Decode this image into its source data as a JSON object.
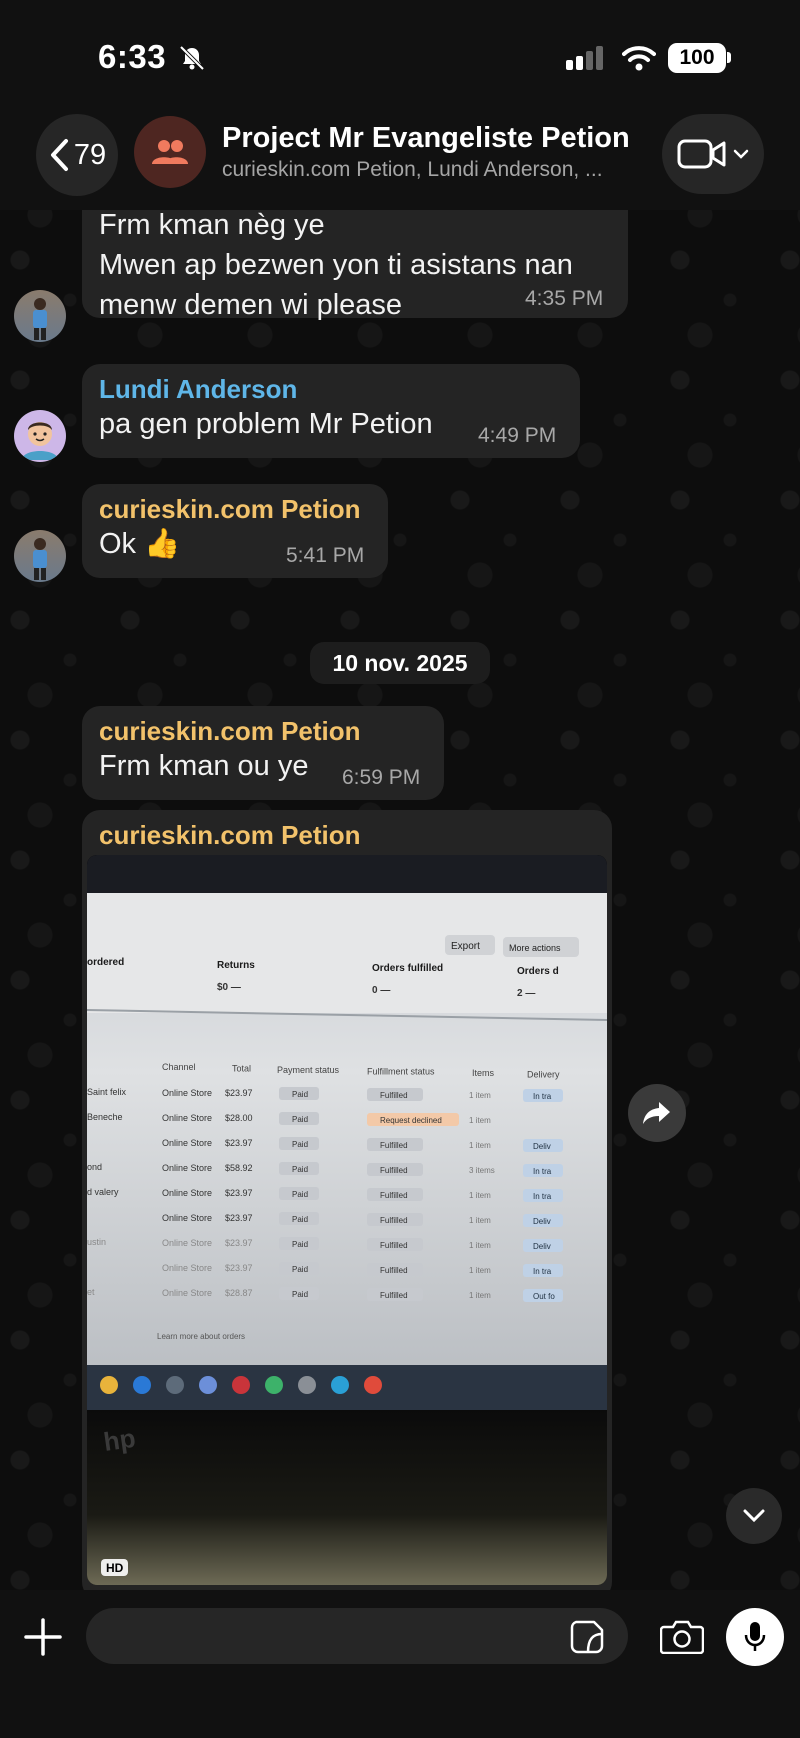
{
  "status_bar": {
    "time": "6:33",
    "battery": "100"
  },
  "header": {
    "back_count": "79",
    "title": "Project Mr Evangeliste Petion",
    "subtitle": "curieskin.com Petion, Lundi Anderson, ..."
  },
  "messages": [
    {
      "sender": "",
      "lines": [
        "Frm kman nèg ye",
        "Mwen ap bezwen yon ti asistans nan",
        "menw demen wi please"
      ],
      "time": "4:35 PM"
    },
    {
      "sender": "Lundi Anderson",
      "sender_color": "#5fb6e8",
      "text": "pa gen problem Mr Petion",
      "time": "4:49 PM"
    },
    {
      "sender": "curieskin.com Petion",
      "sender_color": "#f2c26b",
      "text": "Ok 👍",
      "time": "5:41 PM"
    },
    {
      "sender": "curieskin.com Petion",
      "sender_color": "#f2c26b",
      "text": "Frm kman ou ye",
      "time": "6:59 PM"
    },
    {
      "sender": "curieskin.com Petion",
      "sender_color": "#f2c26b",
      "photo_badge": "HD"
    }
  ],
  "date_separator": "10 nov. 2025",
  "photo_content": {
    "buttons": [
      "Export",
      "More actions"
    ],
    "summary": [
      {
        "label": "ordered",
        "value": ""
      },
      {
        "label": "Returns",
        "value": "$0 —"
      },
      {
        "label": "Orders fulfilled",
        "value": "0 —"
      },
      {
        "label": "Orders d",
        "value": "2 —"
      }
    ],
    "columns": [
      "Channel",
      "Total",
      "Payment status",
      "Fulfillment status",
      "Items",
      "Delivery"
    ],
    "rows": [
      {
        "customer": "Saint felix",
        "channel": "Online Store",
        "total": "$23.97",
        "payment": "Paid",
        "fulfillment": "Fulfilled",
        "items": "1 item",
        "delivery": "In tra"
      },
      {
        "customer": "Beneche",
        "channel": "Online Store",
        "total": "$28.00",
        "payment": "Paid",
        "fulfillment": "Request declined",
        "items": "1 item",
        "delivery": ""
      },
      {
        "customer": "",
        "channel": "Online Store",
        "total": "$23.97",
        "payment": "Paid",
        "fulfillment": "Fulfilled",
        "items": "1 item",
        "delivery": "Deliv"
      },
      {
        "customer": "ond",
        "channel": "Online Store",
        "total": "$58.92",
        "payment": "Paid",
        "fulfillment": "Fulfilled",
        "items": "3 items",
        "delivery": "In tra"
      },
      {
        "customer": "d valery",
        "channel": "Online Store",
        "total": "$23.97",
        "payment": "Paid",
        "fulfillment": "Fulfilled",
        "items": "1 item",
        "delivery": "In tra"
      },
      {
        "customer": "",
        "channel": "Online Store",
        "total": "$23.97",
        "payment": "Paid",
        "fulfillment": "Fulfilled",
        "items": "1 item",
        "delivery": "Deliv"
      },
      {
        "customer": "ustin",
        "channel": "Online Store",
        "total": "$23.97",
        "payment": "Paid",
        "fulfillment": "Fulfilled",
        "items": "1 item",
        "delivery": "Deliv"
      },
      {
        "customer": "",
        "channel": "Online Store",
        "total": "$23.97",
        "payment": "Paid",
        "fulfillment": "Fulfilled",
        "items": "1 item",
        "delivery": "In tra"
      },
      {
        "customer": "et",
        "channel": "Online Store",
        "total": "$28.87",
        "payment": "Paid",
        "fulfillment": "Fulfilled",
        "items": "1 item",
        "delivery": "Out fo"
      }
    ],
    "footer_link": "Learn more about orders",
    "laptop_brand": "hp"
  },
  "input": {
    "placeholder": ""
  },
  "colors": {
    "background": "#0b0b0b",
    "bubble": "#242424",
    "sender_lundi": "#5fb6e8",
    "sender_curieskin": "#f2c26b"
  },
  "icons": [
    "bell-slash-icon",
    "signal-icon",
    "wifi-icon",
    "chevron-left-icon",
    "group-icon",
    "video-camera-icon",
    "chevron-down-icon",
    "forward-icon",
    "plus-icon",
    "sticker-icon",
    "camera-icon",
    "microphone-icon"
  ]
}
